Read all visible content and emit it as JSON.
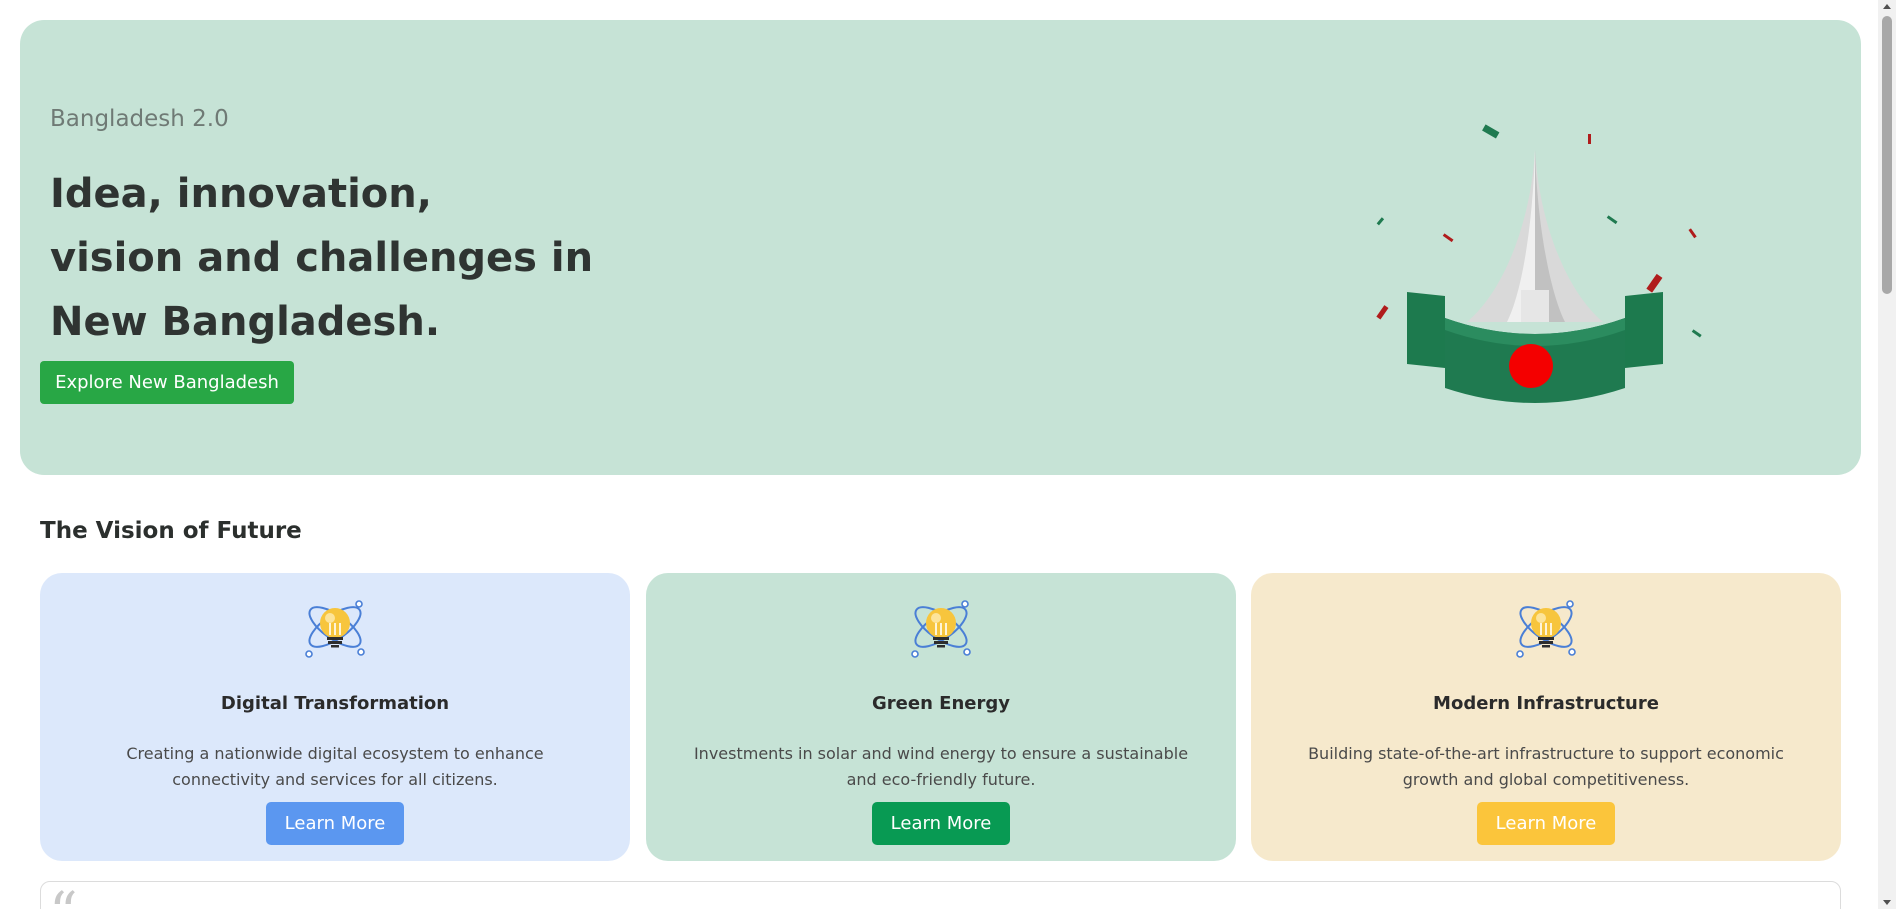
{
  "hero": {
    "eyebrow": "Bangladesh 2.0",
    "title_lines": [
      "Idea, innovation,",
      "vision and challenges in",
      "New Bangladesh."
    ],
    "button_label": "Explore New Bangladesh",
    "illustration": "national-monument-flag-icon"
  },
  "vision": {
    "title": "The Vision of Future",
    "cards": [
      {
        "title": "Digital Transformation",
        "description": "Creating a nationwide digital ecosystem to enhance connectivity and services for all citizens.",
        "button_label": "Learn More",
        "icon": "lightbulb-atom-icon"
      },
      {
        "title": "Green Energy",
        "description": "Investments in solar and wind energy to ensure a sustainable and eco-friendly future.",
        "button_label": "Learn More",
        "icon": "lightbulb-atom-icon"
      },
      {
        "title": "Modern Infrastructure",
        "description": "Building state-of-the-art infrastructure to support economic growth and global competitiveness.",
        "button_label": "Learn More",
        "icon": "lightbulb-atom-icon"
      }
    ]
  },
  "testimonial": {
    "quote_mark": "“"
  },
  "colors": {
    "hero_bg": "#c6e3d6",
    "primary_green": "#28a745",
    "card_blue_bg": "#dce8fb",
    "card_green_bg": "#c6e3d6",
    "card_yellow_bg": "#f6e9cc",
    "btn_blue": "#5b97f0",
    "btn_green": "#089a53",
    "btn_yellow": "#fbc53b"
  }
}
